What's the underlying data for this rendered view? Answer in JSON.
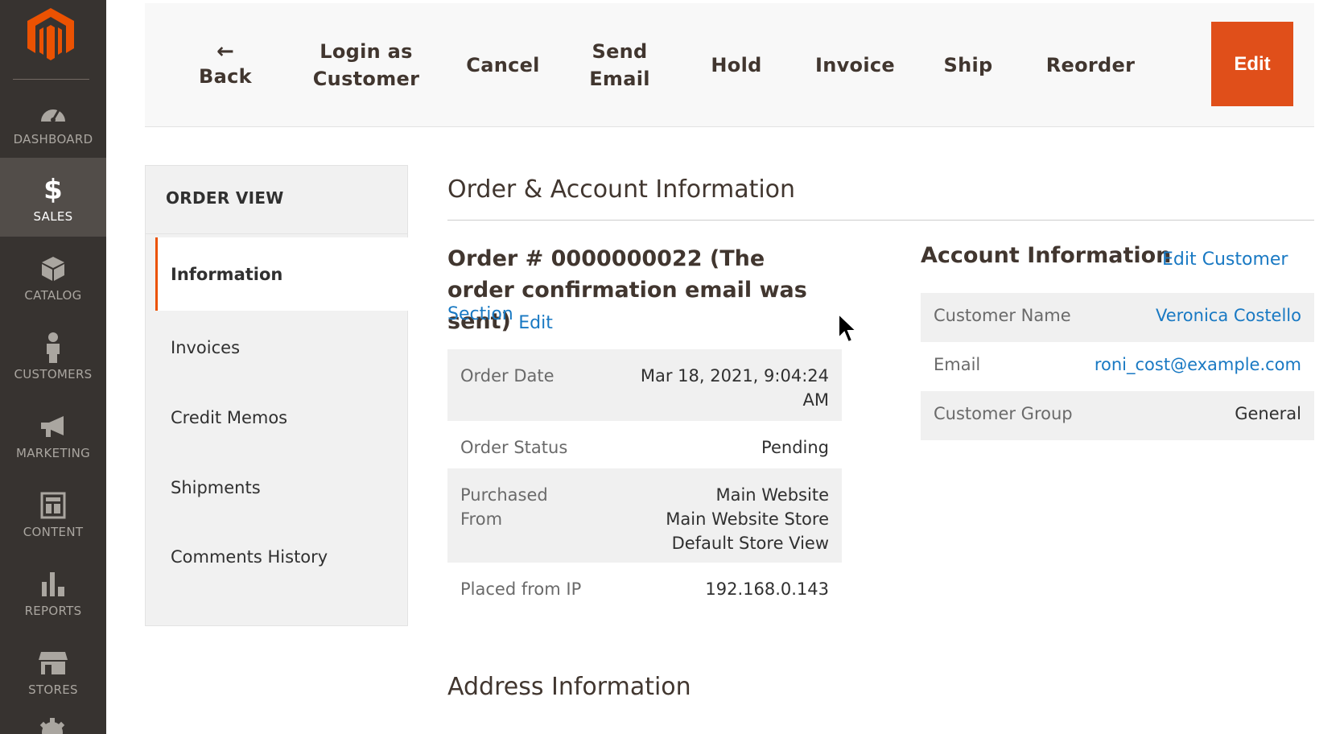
{
  "sidebar": {
    "logo": "magento-logo",
    "items": [
      {
        "label": "DASHBOARD",
        "icon": "dashboard-gauge-icon"
      },
      {
        "label": "SALES",
        "icon": "dollar-icon",
        "active": true
      },
      {
        "label": "CATALOG",
        "icon": "box-icon"
      },
      {
        "label": "CUSTOMERS",
        "icon": "person-icon"
      },
      {
        "label": "MARKETING",
        "icon": "megaphone-icon"
      },
      {
        "label": "CONTENT",
        "icon": "layout-icon"
      },
      {
        "label": "REPORTS",
        "icon": "bar-chart-icon"
      },
      {
        "label": "STORES",
        "icon": "storefront-icon"
      }
    ]
  },
  "toolbar": {
    "back_arrow": "←",
    "back": "Back",
    "login_as_customer_l1": "Login as",
    "login_as_customer_l2": "Customer",
    "cancel": "Cancel",
    "send_email_l1": "Send",
    "send_email_l2": "Email",
    "hold": "Hold",
    "invoice": "Invoice",
    "ship": "Ship",
    "reorder": "Reorder",
    "edit": "Edit"
  },
  "order_view": {
    "title": "ORDER VIEW",
    "tabs": [
      {
        "label": "Information",
        "active": true
      },
      {
        "label": "Invoices"
      },
      {
        "label": "Credit Memos"
      },
      {
        "label": "Shipments"
      },
      {
        "label": "Comments History"
      }
    ]
  },
  "order_account": {
    "section_title": "Order & Account Information",
    "order_heading": "Order # 0000000022 (The order confirmation email was sent)",
    "edit_section_l1": "Edit",
    "edit_section_l2": "Section",
    "order_info": [
      {
        "label": "Order Date",
        "value_l1": "Mar 18, 2021, 9:04:24",
        "value_l2": "AM"
      },
      {
        "label": "Order Status",
        "value_l1": "Pending"
      },
      {
        "label_l1": "Purchased",
        "label_l2": "From",
        "value_l1": "Main Website",
        "value_l2": "Main Website Store",
        "value_l3": "Default Store View"
      },
      {
        "label": "Placed from IP",
        "value_l1": "192.168.0.143"
      }
    ],
    "account_heading": "Account Information",
    "edit_customer": "Edit Customer",
    "account_info": [
      {
        "label": "Customer Name",
        "value": "Veronica Costello"
      },
      {
        "label": "Email",
        "value": "roni_cost@example.com"
      },
      {
        "label": "Customer Group",
        "value": "General"
      }
    ]
  },
  "address": {
    "section_title": "Address Information"
  },
  "colors": {
    "sidebar_bg": "#373330",
    "sidebar_active": "#524d49",
    "accent": "#e04f1a",
    "link": "#1979c3"
  }
}
